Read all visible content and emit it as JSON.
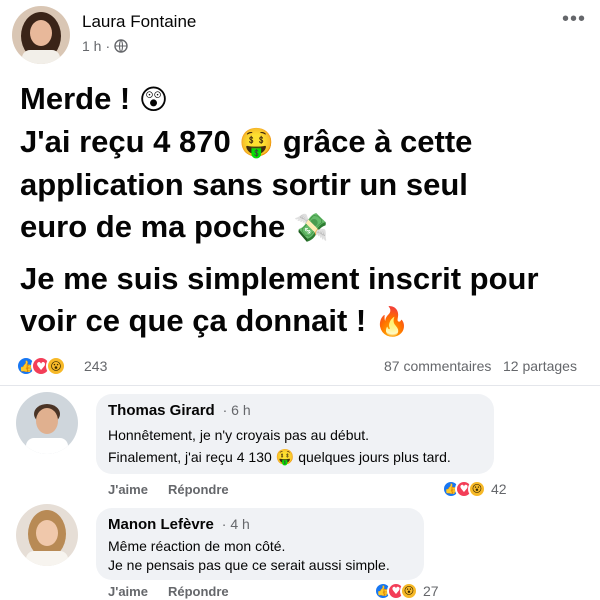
{
  "post": {
    "author": "Laura Fontaine",
    "time": "1 h",
    "dot": "·",
    "more": "•••",
    "line1": "Merde ! ",
    "line1_emoji": "😲",
    "line2a": "J'ai reçu 4 870 ",
    "line2_emoji": "🤑",
    "line2b": " grâce à cette",
    "line3": "application sans sortir un seul",
    "line4": "euro de ma poche ",
    "line4_emoji": "💸",
    "p2_line1": "Je me suis simplement inscrit pour",
    "p2_line2": "voir ce que ça donnait ! ",
    "p2_emoji": "🔥"
  },
  "stats": {
    "reactions": "243",
    "comments": "87 commentaires",
    "shares": "12 partages",
    "icons": [
      "like-icon",
      "love-icon",
      "wow-icon"
    ]
  },
  "comments": [
    {
      "name": "Thomas Girard",
      "time": "6 h",
      "line1": "Honnêtement, je n'y croyais pas au début.",
      "line2a": "Finalement, j'ai reçu 4 130 ",
      "line2_emoji": "🤑",
      "line2b": " quelques jours plus tard.",
      "like": "J'aime",
      "reply": "Répondre",
      "reactions": "42"
    },
    {
      "name": "Manon Lefèvre",
      "time": "4 h",
      "line1": "Même réaction de mon côté.",
      "line2": "Je ne pensais pas que ce serait aussi simple.",
      "like": "J'aime",
      "reply": "Répondre",
      "reactions": "27"
    }
  ],
  "colors": {
    "like": "#1877f2",
    "love": "#f33e58",
    "wow": "#f7b928",
    "bubble": "#f0f2f5",
    "muted": "#65676b"
  }
}
